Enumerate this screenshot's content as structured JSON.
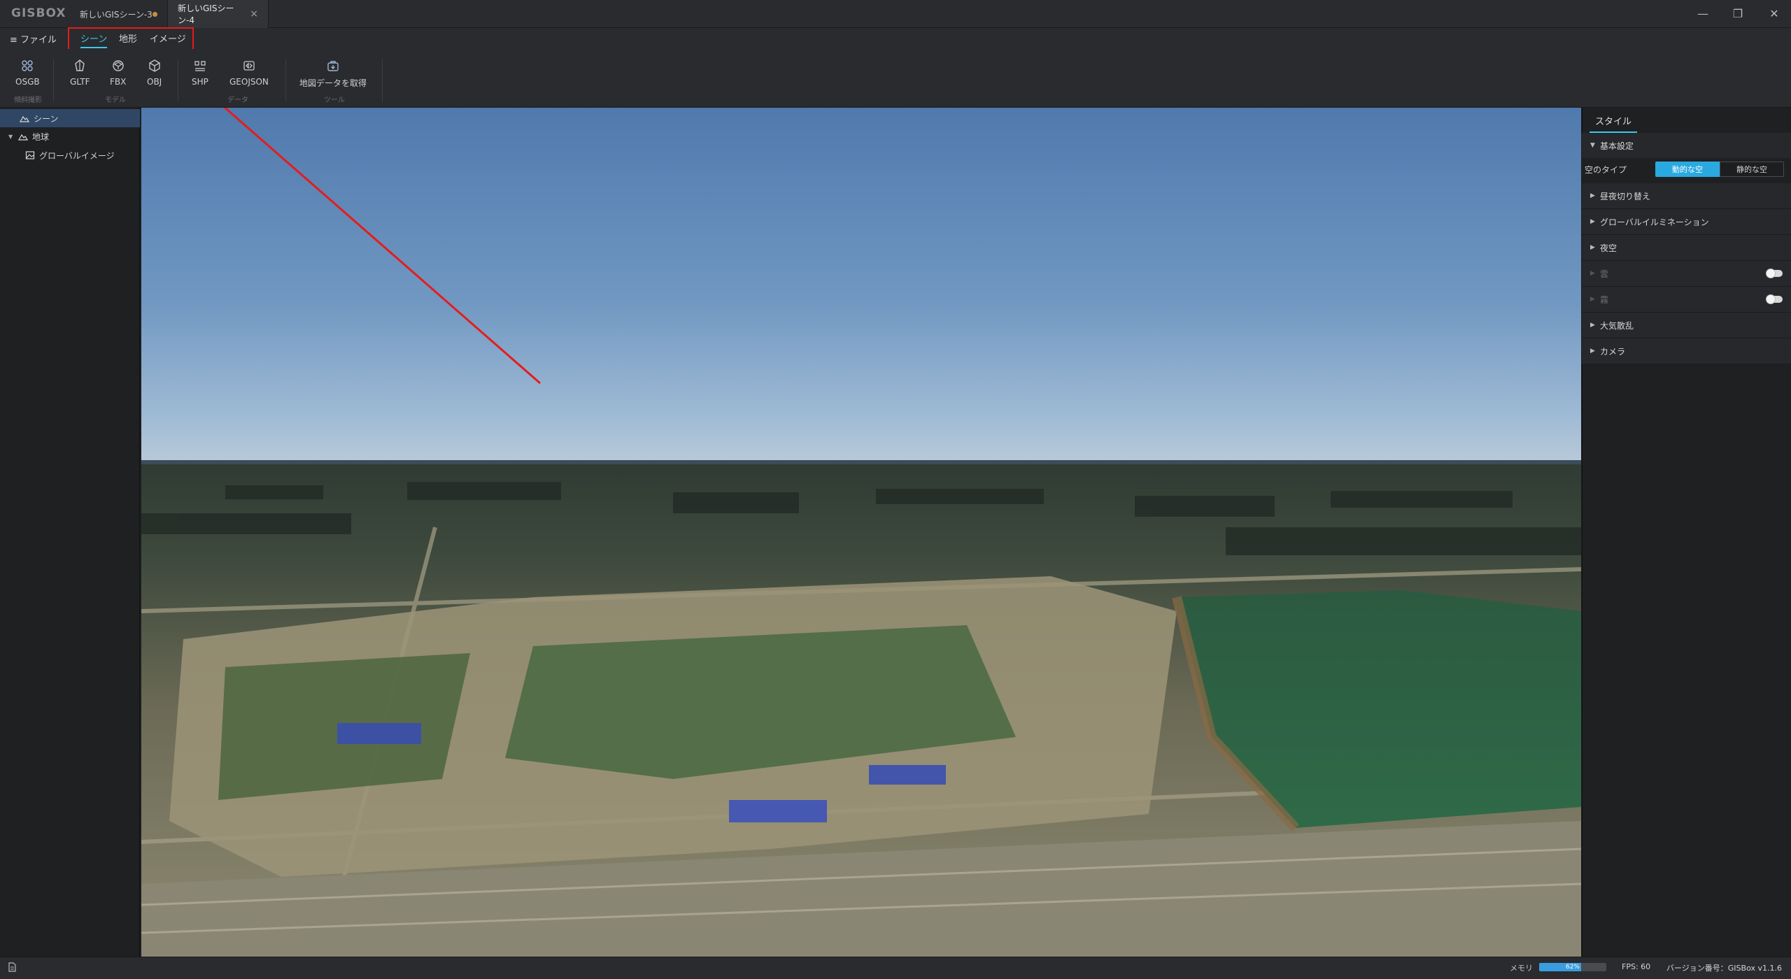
{
  "app": {
    "logo": "GISBOX"
  },
  "tabs": [
    {
      "label": "新しいGISシーン-3",
      "modified": true
    },
    {
      "label": "新しいGISシーン-4",
      "active": true,
      "close": "×"
    }
  ],
  "window_controls": {
    "minimize": "—",
    "restore": "❐",
    "close": "✕"
  },
  "menu": {
    "file": "≡ ファイル",
    "ribbon_tabs": [
      "シーン",
      "地形",
      "イメージ"
    ],
    "active_tab": "シーン"
  },
  "ribbon": {
    "tools": [
      "OSGB",
      "GLTF",
      "FBX",
      "OBJ",
      "SHP",
      "GEOJSON",
      "地図データを取得"
    ],
    "groups": [
      "傾斜撮影",
      "モデル",
      "データ",
      "ツール"
    ]
  },
  "tree": {
    "scene": "シーン",
    "earth": "地球",
    "global_image": "グローバルイメージ"
  },
  "right_panel": {
    "tab": "スタイル",
    "basic": "基本設定",
    "sky_type_label": "空のタイプ",
    "sky_dynamic": "動的な空",
    "sky_static": "静的な空",
    "sections": [
      "昼夜切り替え",
      "グローバルイルミネーション",
      "夜空",
      "雲",
      "霧",
      "大気散乱",
      "カメラ"
    ]
  },
  "status": {
    "memory_label": "メモリ",
    "memory_percent": 62,
    "memory_text": "62%",
    "fps": "FPS: 60",
    "version": "バージョン番号：GISBox v1.1.6"
  },
  "colors": {
    "accent": "#3cc8ee",
    "primary_button": "#2aa9e0",
    "annotation": "#e51c1c"
  }
}
